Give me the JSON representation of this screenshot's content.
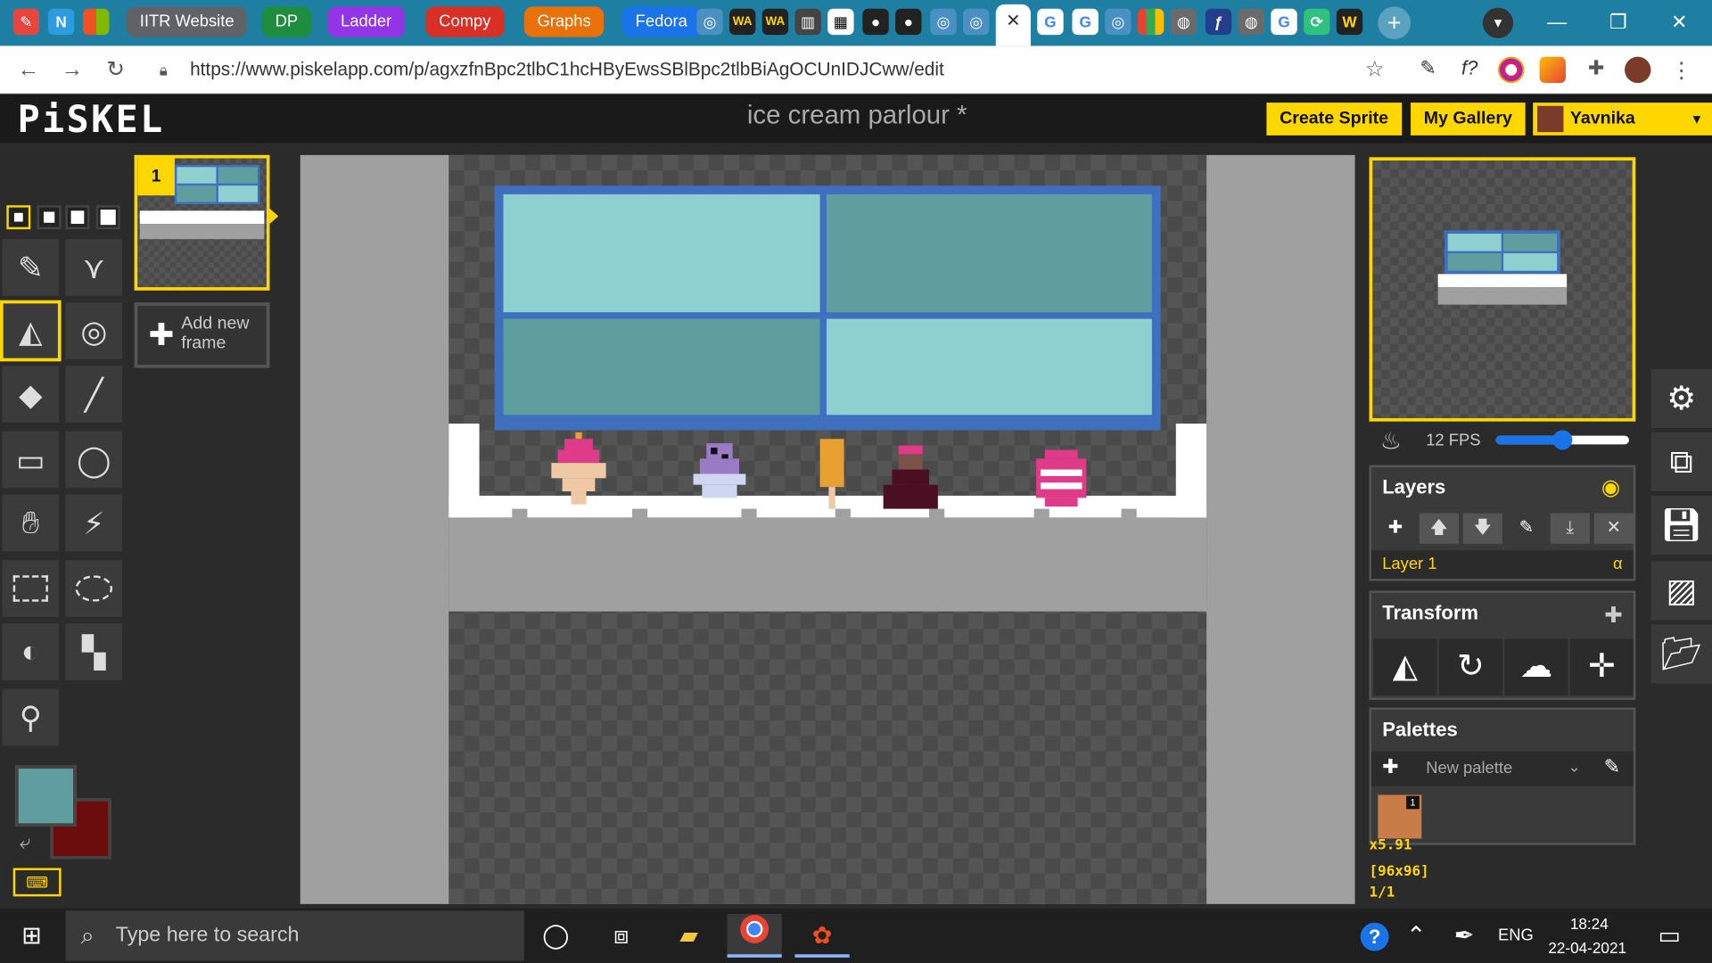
{
  "browser": {
    "tab_groups": [
      {
        "label": "IITR Website",
        "color": "#5f6368"
      },
      {
        "label": "DP",
        "color": "#1e8e3e"
      },
      {
        "label": "Ladder",
        "color": "#9334e6"
      },
      {
        "label": "Compy",
        "color": "#d93025"
      },
      {
        "label": "Graphs",
        "color": "#e8710a"
      },
      {
        "label": "Fedora",
        "color": "#1a73e8"
      }
    ],
    "active_tab_close": "✕",
    "new_tab": "+",
    "url": "https://www.piskelapp.com/p/agxzfnBpc2tlbC1hcHByEwsSBlBpc2tlbBiAgOCUnIDJCww/edit",
    "window": {
      "minimize": "—",
      "restore": "❐",
      "close": "✕"
    }
  },
  "app": {
    "logo": "PiSKEL",
    "title": "ice cream parlour *",
    "create_sprite": "Create Sprite",
    "my_gallery": "My Gallery",
    "user_name": "Yavnika Garg"
  },
  "frames": {
    "frame_number": "1",
    "add_new_frame_line1": "Add new",
    "add_new_frame_line2": "frame"
  },
  "colors": {
    "primary": "#5f9ea0",
    "secondary": "#6b0d0d",
    "palette_swatch": "#c87d48",
    "palette_swatch_index": "1"
  },
  "preview": {
    "fps_label": "12 FPS",
    "fps_value": 12
  },
  "layers": {
    "title": "Layers",
    "items": [
      {
        "name": "Layer 1",
        "alpha": "α"
      }
    ]
  },
  "transform": {
    "title": "Transform"
  },
  "palettes": {
    "title": "Palettes",
    "selected": "New palette"
  },
  "status": {
    "zoom": "x5.91",
    "size": "[96x96]",
    "frame_index": "1/1"
  },
  "taskbar": {
    "search_placeholder": "Type here to search",
    "language": "ENG",
    "time": "18:24",
    "date": "22-04-2021"
  }
}
